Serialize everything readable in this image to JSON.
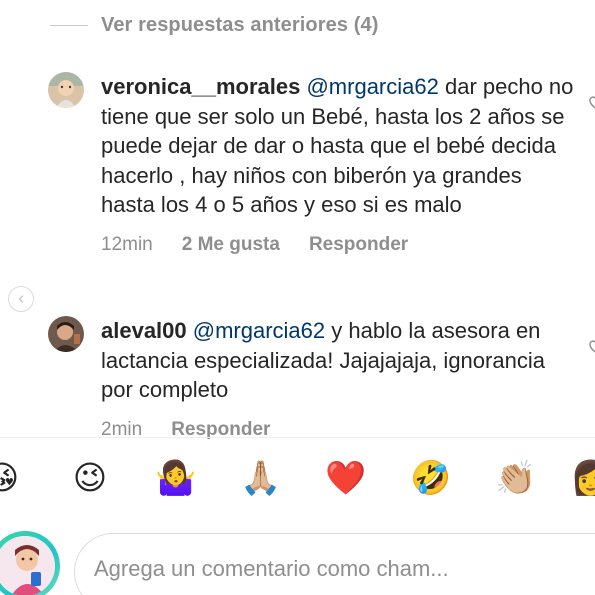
{
  "thread": {
    "previous_replies_label": "Ver respuestas anteriores (4)"
  },
  "comments": [
    {
      "username": "veronica__morales",
      "mention": "@mrgarcia62",
      "text": " dar pecho no tiene que ser solo un Bebé, hasta los 2 años se puede dejar de dar o hasta que el bebé decida hacerlo , hay niños con biberón ya grandes hasta los 4 o 5 años y eso si es malo",
      "time": "12min",
      "likes": "2 Me gusta",
      "reply_label": "Responder"
    },
    {
      "username": "aleval00",
      "mention": "@mrgarcia62",
      "text": " y hablo la asesora en lactancia especializada! Jajajajaja, ignorancia por completo",
      "time": "2min",
      "reply_label": "Responder"
    }
  ],
  "emoji_bar": [
    {
      "name": "face-blowing-kiss-emoji",
      "glyph": "😘"
    },
    {
      "name": "winking-face-emoji",
      "glyph": "😉"
    },
    {
      "name": "person-shrugging-emoji",
      "glyph": "🤷‍♀️"
    },
    {
      "name": "folded-hands-emoji",
      "glyph": "🙏🏼"
    },
    {
      "name": "red-heart-emoji",
      "glyph": "❤️"
    },
    {
      "name": "rolling-on-floor-laughing-emoji",
      "glyph": "🤣"
    },
    {
      "name": "clapping-hands-emoji",
      "glyph": "👏🏼"
    },
    {
      "name": "woman-emoji",
      "glyph": "👩"
    }
  ],
  "composer": {
    "placeholder": "Agrega un comentario como cham..."
  }
}
